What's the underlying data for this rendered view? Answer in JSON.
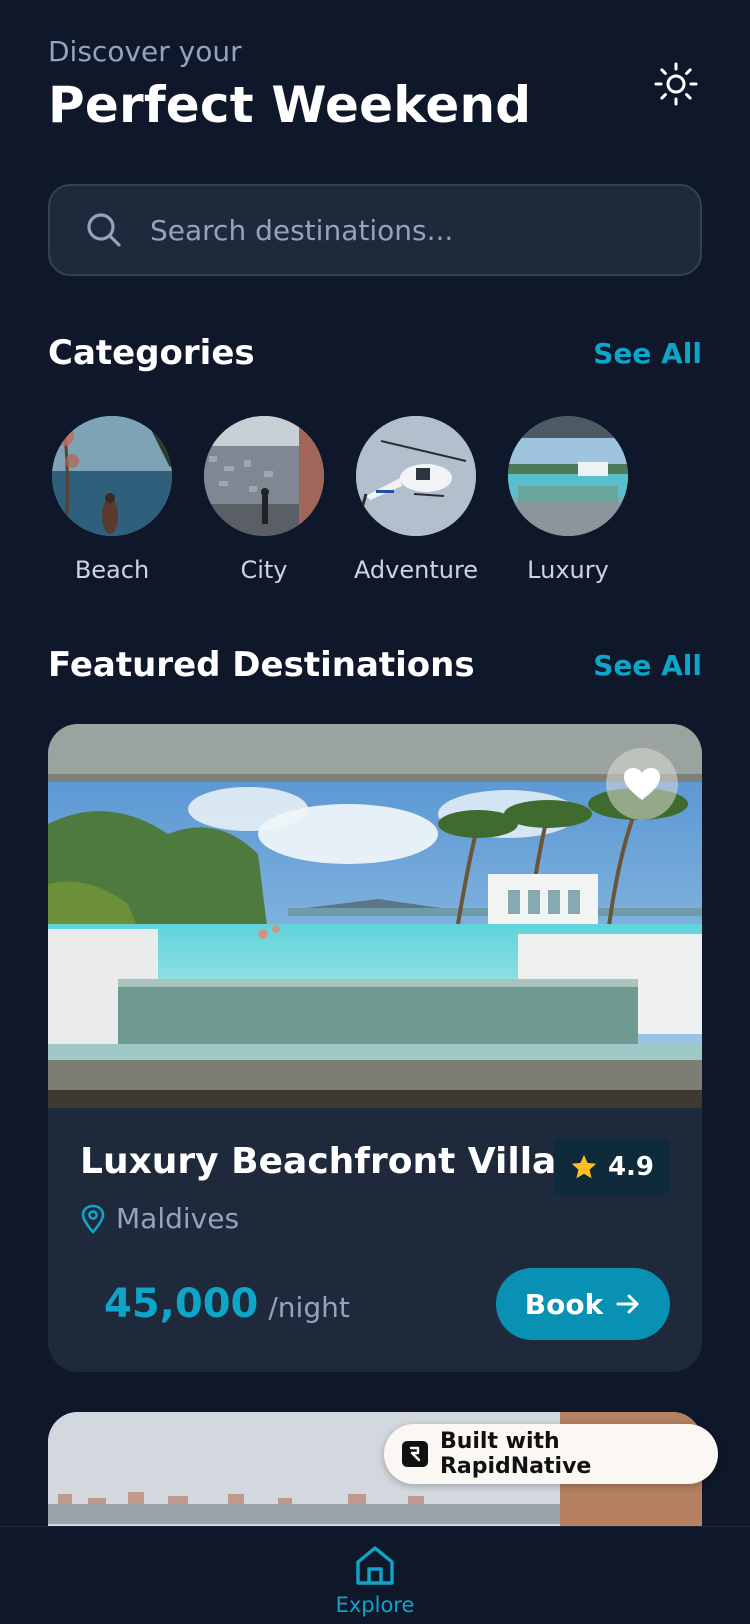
{
  "header": {
    "subtitle": "Discover your",
    "title": "Perfect Weekend",
    "theme_icon": "sun-icon"
  },
  "search": {
    "placeholder": "Search destinations..."
  },
  "categories": {
    "title": "Categories",
    "see_all": "See All",
    "items": [
      {
        "label": "Beach"
      },
      {
        "label": "City"
      },
      {
        "label": "Adventure"
      },
      {
        "label": "Luxury"
      }
    ]
  },
  "featured": {
    "title": "Featured Destinations",
    "see_all": "See All",
    "card": {
      "title": "Luxury Beachfront Villa",
      "rating": "4.9",
      "location": "Maldives",
      "price": "45,000",
      "price_unit": "/night",
      "book_label": "Book"
    }
  },
  "badge": {
    "text": "Built with RapidNative"
  },
  "tabbar": {
    "items": [
      {
        "label": "Explore",
        "icon": "home-icon"
      }
    ]
  },
  "colors": {
    "background": "#0f172a",
    "surface": "#1e293b",
    "accent": "#0ea5c9",
    "star": "#fbbf24"
  }
}
